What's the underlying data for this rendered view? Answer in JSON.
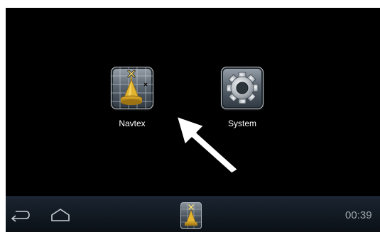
{
  "apps": [
    {
      "label": "Navtex",
      "icon": "navtex-buoy-icon"
    },
    {
      "label": "System",
      "icon": "system-gear-icon"
    }
  ],
  "navbar": {
    "back_icon": "back-arrow-icon",
    "home_icon": "home-icon",
    "running_app_icon": "navtex-buoy-icon",
    "clock": "00:39"
  },
  "colors": {
    "screen_background": "#000000",
    "navbar_border": "#2f4a66",
    "clock_text": "#9fa6ad",
    "buoy_gold": "#e3b430",
    "pointer_arrow": "#ffffff"
  }
}
